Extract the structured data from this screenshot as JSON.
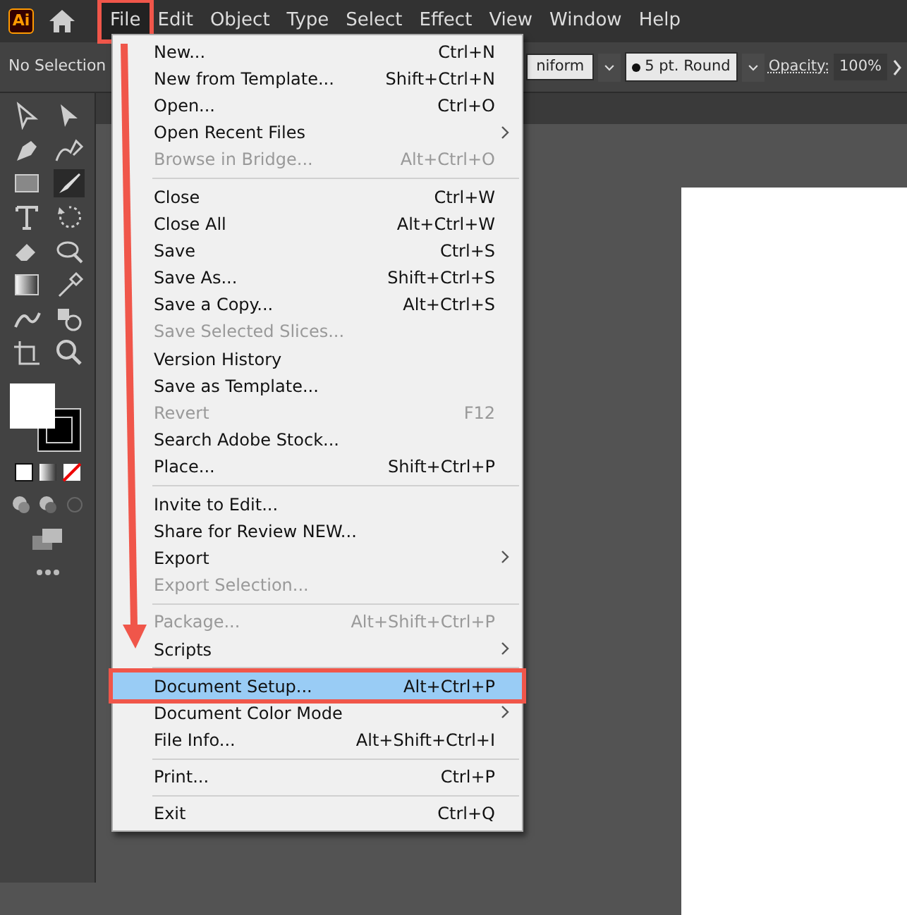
{
  "menubar": {
    "items": [
      {
        "label": "File",
        "selected": true,
        "highlighted": true
      },
      {
        "label": "Edit",
        "selected": false,
        "highlighted": false
      },
      {
        "label": "Object",
        "selected": false,
        "highlighted": false
      },
      {
        "label": "Type",
        "selected": false,
        "highlighted": false
      },
      {
        "label": "Select",
        "selected": false,
        "highlighted": false
      },
      {
        "label": "Effect",
        "selected": false,
        "highlighted": false
      },
      {
        "label": "View",
        "selected": false,
        "highlighted": false
      },
      {
        "label": "Window",
        "selected": false,
        "highlighted": false
      },
      {
        "label": "Help",
        "selected": false,
        "highlighted": false
      }
    ]
  },
  "app_logo": "Ai",
  "control_bar": {
    "selection": "No Selection",
    "profile": "niform",
    "brush": "5 pt. Round",
    "opacity_label": "Opacity:",
    "opacity": "100%"
  },
  "file_menu": [
    {
      "kind": "item",
      "label": "New...",
      "shortcut": "Ctrl+N",
      "submenu": false,
      "disabled": false,
      "selected": false,
      "highlighted": false
    },
    {
      "kind": "item",
      "label": "New from Template...",
      "shortcut": "Shift+Ctrl+N",
      "submenu": false,
      "disabled": false,
      "selected": false,
      "highlighted": false
    },
    {
      "kind": "item",
      "label": "Open...",
      "shortcut": "Ctrl+O",
      "submenu": false,
      "disabled": false,
      "selected": false,
      "highlighted": false
    },
    {
      "kind": "item",
      "label": "Open Recent Files",
      "submenu": true,
      "disabled": false,
      "selected": false,
      "highlighted": false
    },
    {
      "kind": "item",
      "label": "Browse in Bridge...",
      "shortcut": "Alt+Ctrl+O",
      "submenu": false,
      "disabled": true,
      "selected": false,
      "highlighted": false
    },
    {
      "kind": "separator"
    },
    {
      "kind": "item",
      "label": "Close",
      "shortcut": "Ctrl+W",
      "submenu": false,
      "disabled": false,
      "selected": false,
      "highlighted": false
    },
    {
      "kind": "item",
      "label": "Close All",
      "shortcut": "Alt+Ctrl+W",
      "submenu": false,
      "disabled": false,
      "selected": false,
      "highlighted": false
    },
    {
      "kind": "item",
      "label": "Save",
      "shortcut": "Ctrl+S",
      "submenu": false,
      "disabled": false,
      "selected": false,
      "highlighted": false
    },
    {
      "kind": "item",
      "label": "Save As...",
      "shortcut": "Shift+Ctrl+S",
      "submenu": false,
      "disabled": false,
      "selected": false,
      "highlighted": false
    },
    {
      "kind": "item",
      "label": "Save a Copy...",
      "shortcut": "Alt+Ctrl+S",
      "submenu": false,
      "disabled": false,
      "selected": false,
      "highlighted": false
    },
    {
      "kind": "item",
      "label": "Save Selected Slices...",
      "submenu": false,
      "disabled": true,
      "selected": false,
      "highlighted": false
    },
    {
      "kind": "item",
      "label": "Version History",
      "submenu": false,
      "disabled": false,
      "selected": false,
      "highlighted": false
    },
    {
      "kind": "item",
      "label": "Save as Template...",
      "submenu": false,
      "disabled": false,
      "selected": false,
      "highlighted": false
    },
    {
      "kind": "item",
      "label": "Revert",
      "shortcut": "F12",
      "submenu": false,
      "disabled": true,
      "selected": false,
      "highlighted": false
    },
    {
      "kind": "item",
      "label": "Search Adobe Stock...",
      "submenu": false,
      "disabled": false,
      "selected": false,
      "highlighted": false
    },
    {
      "kind": "item",
      "label": "Place...",
      "shortcut": "Shift+Ctrl+P",
      "submenu": false,
      "disabled": false,
      "selected": false,
      "highlighted": false
    },
    {
      "kind": "separator"
    },
    {
      "kind": "item",
      "label": "Invite to Edit...",
      "submenu": false,
      "disabled": false,
      "selected": false,
      "highlighted": false
    },
    {
      "kind": "item",
      "label": "Share for Review NEW...",
      "submenu": false,
      "disabled": false,
      "selected": false,
      "highlighted": false
    },
    {
      "kind": "item",
      "label": "Export",
      "submenu": true,
      "disabled": false,
      "selected": false,
      "highlighted": false
    },
    {
      "kind": "item",
      "label": "Export Selection...",
      "submenu": false,
      "disabled": true,
      "selected": false,
      "highlighted": false
    },
    {
      "kind": "separator"
    },
    {
      "kind": "item",
      "label": "Package...",
      "shortcut": "Alt+Shift+Ctrl+P",
      "submenu": false,
      "disabled": true,
      "selected": false,
      "highlighted": false
    },
    {
      "kind": "item",
      "label": "Scripts",
      "submenu": true,
      "disabled": false,
      "selected": false,
      "highlighted": false
    },
    {
      "kind": "separator"
    },
    {
      "kind": "item",
      "label": "Document Setup...",
      "shortcut": "Alt+Ctrl+P",
      "submenu": false,
      "disabled": false,
      "selected": true,
      "highlighted": true
    },
    {
      "kind": "item",
      "label": "Document Color Mode",
      "submenu": true,
      "disabled": false,
      "selected": false,
      "highlighted": false
    },
    {
      "kind": "item",
      "label": "File Info...",
      "shortcut": "Alt+Shift+Ctrl+I",
      "submenu": false,
      "disabled": false,
      "selected": false,
      "highlighted": false
    },
    {
      "kind": "separator"
    },
    {
      "kind": "item",
      "label": "Print...",
      "shortcut": "Ctrl+P",
      "submenu": false,
      "disabled": false,
      "selected": false,
      "highlighted": false
    },
    {
      "kind": "separator"
    },
    {
      "kind": "item",
      "label": "Exit",
      "shortcut": "Ctrl+Q",
      "submenu": false,
      "disabled": false,
      "selected": false,
      "highlighted": false
    }
  ]
}
